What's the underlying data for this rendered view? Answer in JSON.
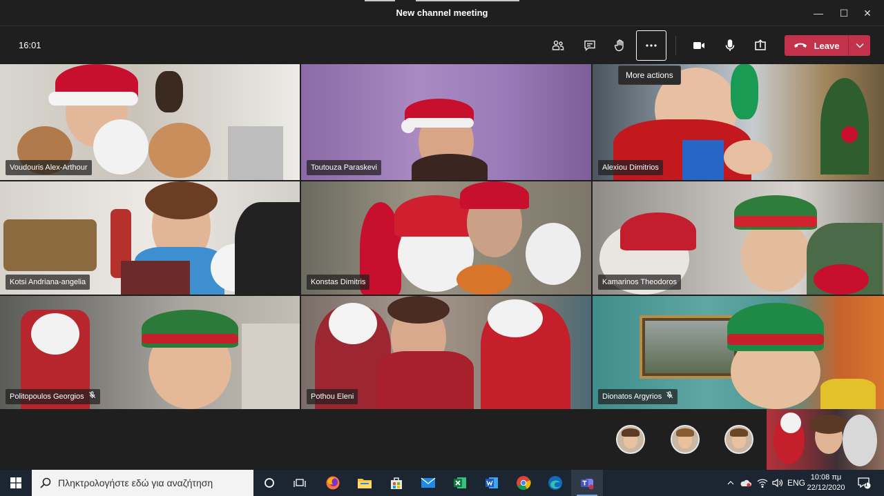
{
  "window": {
    "title": "New channel meeting",
    "minimize": "—",
    "maximize": "☐",
    "close": "✕"
  },
  "toolbar": {
    "time": "16:01",
    "leave_label": "Leave",
    "tooltip": "More actions"
  },
  "participants": [
    {
      "name": "Voudouris Alex-Arthour",
      "muted": false
    },
    {
      "name": "Toutouza Paraskevi",
      "muted": false
    },
    {
      "name": "Alexiou Dimitrios",
      "muted": false
    },
    {
      "name": "Kotsi Andriana-angelia",
      "muted": false
    },
    {
      "name": "Konstas Dimitris",
      "muted": false
    },
    {
      "name": "Kamarinos Theodoros",
      "muted": false
    },
    {
      "name": "Politopoulos Georgios",
      "muted": true
    },
    {
      "name": "Pothou Eleni",
      "muted": false
    },
    {
      "name": "Dionatos Argyrios",
      "muted": true
    }
  ],
  "taskbar": {
    "search_placeholder": "Πληκτρολογήστε εδώ για αναζήτηση",
    "language": "ENG",
    "time": "10:08 πμ",
    "date": "22/12/2020",
    "notification_count": "1"
  },
  "colors": {
    "leave": "#c4314b",
    "background": "#201f1f",
    "taskbar": "#1c2633"
  }
}
